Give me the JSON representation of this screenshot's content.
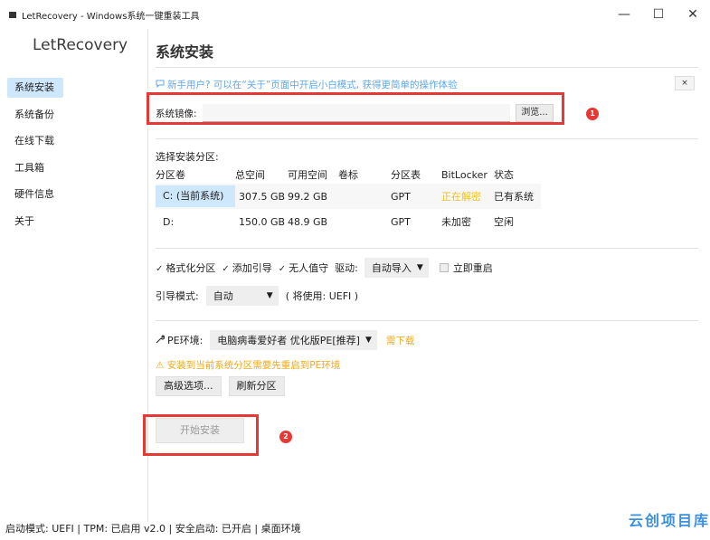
{
  "window": {
    "title": "LetRecovery - Windows系统一键重装工具",
    "controls": {
      "minimize": "—",
      "maximize": "☐",
      "close": "✕"
    }
  },
  "sidebar": {
    "brand": "LetRecovery",
    "items": [
      {
        "label": "系统安装",
        "active": true
      },
      {
        "label": "系统备份",
        "active": false
      },
      {
        "label": "在线下载",
        "active": false
      },
      {
        "label": "工具箱",
        "active": false
      },
      {
        "label": "硬件信息",
        "active": false
      },
      {
        "label": "关于",
        "active": false
      }
    ]
  },
  "main": {
    "title": "系统安装",
    "tip": "新手用户? 可以在“关于”页面中开启小白模式, 获得更简单的操作体验",
    "tip_close": "×",
    "image": {
      "label": "系统镜像:",
      "value": "",
      "browse_label": "浏览..."
    },
    "annotation_1": "1",
    "annotation_2": "2",
    "partition": {
      "label": "选择安装分区:",
      "headers": [
        "分区卷",
        "总空间",
        "可用空间",
        "卷标",
        "分区表",
        "BitLocker",
        "状态"
      ],
      "rows": [
        [
          "C: (当前系统)",
          "307.5 GB",
          "99.2 GB",
          "",
          "GPT",
          "正在解密",
          "已有系统"
        ],
        [
          "D:",
          "150.0 GB",
          "48.9 GB",
          "",
          "GPT",
          "未加密",
          "空闲"
        ]
      ]
    },
    "options": {
      "format": "格式化分区",
      "add_boot": "添加引导",
      "unattended": "无人值守",
      "driver_label": "驱动:",
      "driver_value": "自动导入",
      "reboot": "立即重启"
    },
    "boot": {
      "label": "引导模式:",
      "value": "自动",
      "note": "( 将使用: UEFI )"
    },
    "pe": {
      "label": "PE环境:",
      "value": "电脑病毒爱好者 优化版PE[推荐]",
      "need_download": "需下载",
      "warning": "⚠ 安装到当前系统分区需要先重启到PE环境"
    },
    "buttons": {
      "advanced": "高级选项...",
      "refresh": "刷新分区",
      "start": "开始安装"
    }
  },
  "status_bar": "启动模式: UEFI | TPM: 已启用 v2.0 | 安全启动: 已开启 | 桌面环境",
  "watermark": "云创项目库",
  "colors": {
    "accent_blue": "#cfe7fb",
    "tip_blue": "#5fa8e8",
    "warning_orange": "#f0a818",
    "annotation_red": "#e53935"
  }
}
